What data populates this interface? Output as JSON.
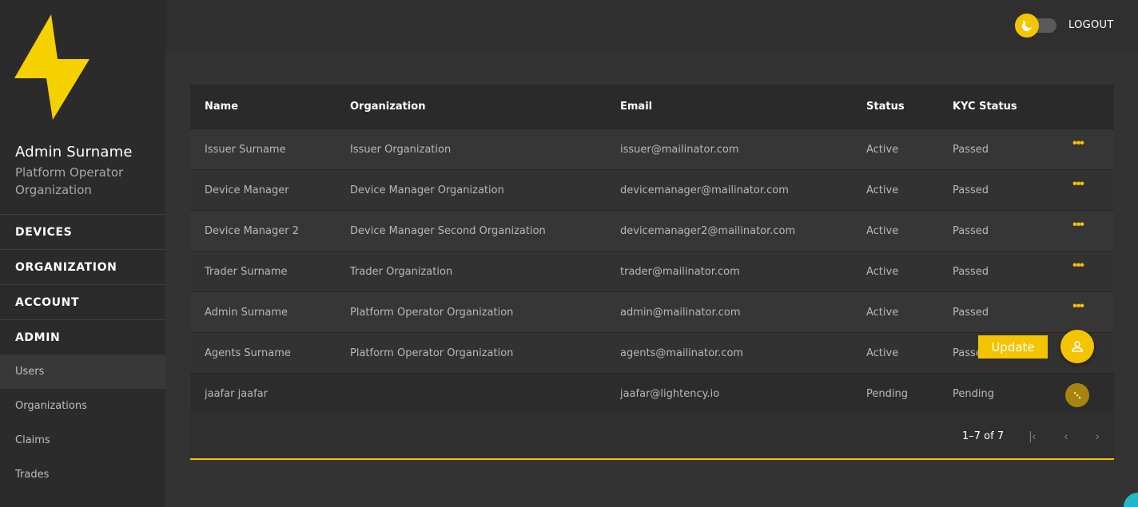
{
  "colors": {
    "accent": "#f5c400",
    "corner_fab": "#1fb9c9"
  },
  "sidebar": {
    "logo_icon": "lightning-bolt-icon",
    "user_name": "Admin Surname",
    "user_org": "Platform Operator Organization",
    "main_items": [
      {
        "label": "DEVICES"
      },
      {
        "label": "ORGANIZATION"
      },
      {
        "label": "ACCOUNT"
      },
      {
        "label": "ADMIN"
      }
    ],
    "sub_items": [
      {
        "label": "Users",
        "active": true
      },
      {
        "label": "Organizations"
      },
      {
        "label": "Claims"
      },
      {
        "label": "Trades"
      }
    ]
  },
  "topbar": {
    "theme_toggle_icon": "moon-sun-icon",
    "logout_label": "LOGOUT"
  },
  "table": {
    "columns": [
      "Name",
      "Organization",
      "Email",
      "Status",
      "KYC Status"
    ],
    "rows": [
      {
        "name": "Issuer Surname",
        "organization": "Issuer Organization",
        "email": "issuer@mailinator.com",
        "status": "Active",
        "kyc": "Passed"
      },
      {
        "name": "Device Manager",
        "organization": "Device Manager Organization",
        "email": "devicemanager@mailinator.com",
        "status": "Active",
        "kyc": "Passed"
      },
      {
        "name": "Device Manager 2",
        "organization": "Device Manager Second Organization",
        "email": "devicemanager2@mailinator.com",
        "status": "Active",
        "kyc": "Passed"
      },
      {
        "name": "Trader Surname",
        "organization": "Trader Organization",
        "email": "trader@mailinator.com",
        "status": "Active",
        "kyc": "Passed"
      },
      {
        "name": "Admin Surname",
        "organization": "Platform Operator Organization",
        "email": "admin@mailinator.com",
        "status": "Active",
        "kyc": "Passed"
      },
      {
        "name": "Agents Surname",
        "organization": "Platform Operator Organization",
        "email": "agents@mailinator.com",
        "status": "Active",
        "kyc": "Passed"
      },
      {
        "name": "jaafar jaafar",
        "organization": "",
        "email": "jaafar@lightency.io",
        "status": "Pending",
        "kyc": "Pending"
      }
    ],
    "pagination": {
      "range": "1–7 of 7",
      "first_icon": "first-page-icon",
      "prev_icon": "chevron-left-icon",
      "next_icon": "chevron-right-icon"
    }
  },
  "actions": {
    "update_label": "Update",
    "fab_icon": "user-icon"
  }
}
